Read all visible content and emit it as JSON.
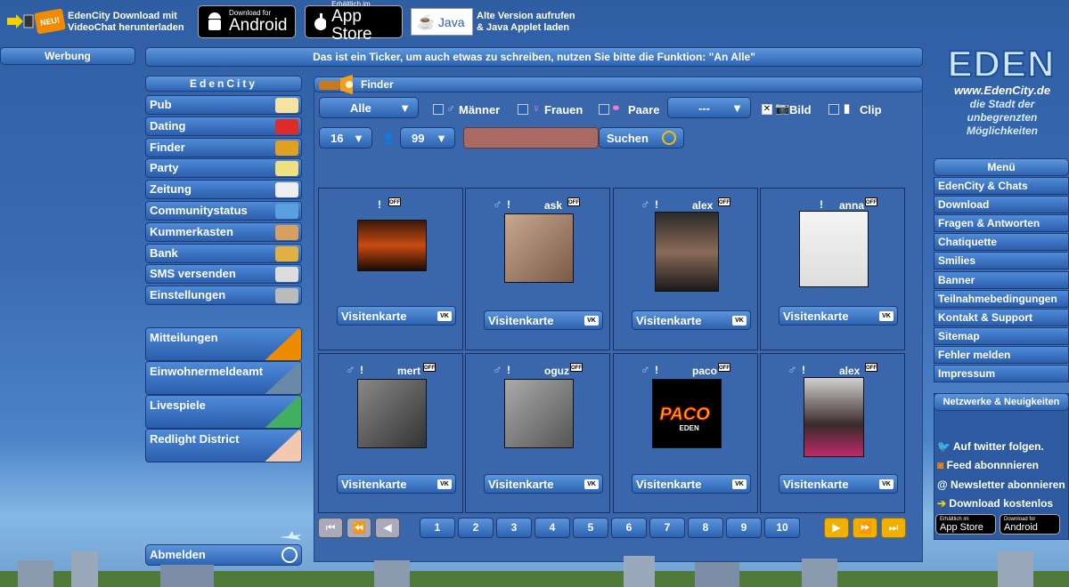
{
  "top": {
    "promo1_line1": "EdenCity Download mit",
    "promo1_line2": "VideoChat herunterladen",
    "neu_badge": "NEU!",
    "android_small": "Download for",
    "android_big": "Android",
    "appstore_small": "Erhältlich im",
    "appstore_big": "App Store",
    "java_label": "Java",
    "java_line1": "Alte Version aufrufen",
    "java_line2": "& Java Applet laden"
  },
  "ad_label": "Werbung",
  "ticker": "Das ist ein Ticker, um auch etwas zu schreiben, nutzen Sie bitte die Funktion: \"An Alle\"",
  "sidebar": {
    "title": "EdenCity",
    "items": [
      {
        "label": "Pub",
        "icon": "beer-icon"
      },
      {
        "label": "Dating",
        "icon": "hearts-icon"
      },
      {
        "label": "Finder",
        "icon": "flashlight-icon"
      },
      {
        "label": "Party",
        "icon": "cocktail-icon"
      },
      {
        "label": "Zeitung",
        "icon": "newspaper-icon"
      },
      {
        "label": "Communitystatus",
        "icon": "city-icon"
      },
      {
        "label": "Kummerkasten",
        "icon": "mailbox-icon"
      },
      {
        "label": "Bank",
        "icon": "moneybag-icon"
      },
      {
        "label": "SMS versenden",
        "icon": "sms-icon"
      },
      {
        "label": "Einstellungen",
        "icon": "gears-icon"
      }
    ],
    "big_items": [
      {
        "label": "Mitteilungen",
        "icon": "megaphone-icon"
      },
      {
        "label": "Einwohnermeldeamt",
        "icon": "building-icon"
      },
      {
        "label": "Livespiele",
        "icon": "dice-icon"
      },
      {
        "label": "Redlight District",
        "icon": "woman-icon"
      }
    ],
    "logout": "Abmelden"
  },
  "finder": {
    "title": "Finder",
    "filter_all": "Alle",
    "men": "Männer",
    "women": "Frauen",
    "couples": "Paare",
    "select_dash": "---",
    "bild": "Bild",
    "clip": "Clip",
    "age_from": "16",
    "age_to": "99",
    "search_label": "Suchen",
    "search_value": "",
    "cards": [
      {
        "name": "",
        "gender": "",
        "status": "OFF",
        "vk": "Visitenkarte"
      },
      {
        "name": "ask",
        "gender": "♂",
        "status": "OFF",
        "vk": "Visitenkarte"
      },
      {
        "name": "alex",
        "gender": "♂",
        "status": "OFF",
        "vk": "Visitenkarte"
      },
      {
        "name": "anna",
        "gender": "",
        "status": "OFF",
        "vk": "Visitenkarte"
      },
      {
        "name": "mert",
        "gender": "♂",
        "status": "OFF",
        "vk": "Visitenkarte"
      },
      {
        "name": "oguz",
        "gender": "♂",
        "status": "OFF",
        "vk": "Visitenkarte"
      },
      {
        "name": "paco",
        "gender": "♂",
        "status": "OFF",
        "vk": "Visitenkarte"
      },
      {
        "name": "alex",
        "gender": "♂",
        "status": "OFF",
        "vk": "Visitenkarte"
      }
    ],
    "vk_badge": "VK",
    "pages": [
      "1",
      "2",
      "3",
      "4",
      "5",
      "6",
      "7",
      "8",
      "9",
      "10"
    ],
    "paco_logo": "PACO",
    "paco_logo_sub": "EDEN"
  },
  "right": {
    "logo": "EDEN",
    "url": "www.EdenCity.de",
    "slogan_1": "die Stadt der",
    "slogan_2": "unbegrenzten",
    "slogan_3": "Möglichkeiten",
    "menu_title": "Menü",
    "menu": [
      "EdenCity & Chats",
      "Download",
      "Fragen & Antworten",
      "Chatiquette",
      "Smilies",
      "Banner",
      "Teilnahmebedingungen",
      "Kontakt & Support",
      "Sitemap",
      "Fehler melden",
      "Impressum"
    ],
    "net_title": "Netzwerke & Neuigkeiten",
    "twitter": "Auf twitter folgen.",
    "feed": "Feed abonnnieren",
    "newsletter": "Newsletter abonnieren",
    "download": "Download kostenlos",
    "appstore_small": "Erhältlich im",
    "appstore_big": "App Store",
    "android_small": "Download for",
    "android_big": "Android"
  },
  "colors": {
    "accent": "#2d64b2",
    "panel": "#3a66ab",
    "search_field": "#a86a62"
  }
}
